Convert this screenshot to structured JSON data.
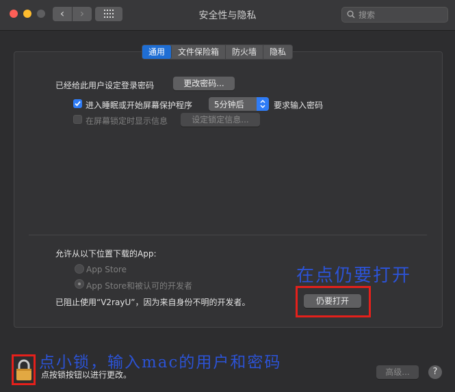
{
  "window": {
    "title": "安全性与隐私"
  },
  "search": {
    "placeholder": "搜索"
  },
  "tabs": [
    "通用",
    "文件保险箱",
    "防火墙",
    "隐私"
  ],
  "general": {
    "password_set_label": "已经给此用户设定登录密码",
    "change_password_button": "更改密码...",
    "require_password_prefix": "进入睡眠或开始屏幕保护程序",
    "require_password_delay": "5分钟后",
    "require_password_suffix": "要求输入密码",
    "require_password_checked": true,
    "show_message_label": "在屏幕锁定时显示信息",
    "show_message_checked": false,
    "set_lock_message_button": "设定锁定信息..."
  },
  "downloads": {
    "heading": "允许从以下位置下载的App:",
    "options": [
      "App Store",
      "App Store和被认可的开发者"
    ],
    "selected_index": 1,
    "blocked_message": "已阻止使用“V2rayU”，因为来自身份不明的开发者。",
    "open_anyway_button": "仍要打开"
  },
  "footer": {
    "lock_hint": "点按锁按钮以进行更改。",
    "advanced_button": "高级...",
    "help_button": "?"
  },
  "annotations": {
    "open_anyway_note": "在点仍要打开",
    "lock_note": "点小锁，输入mac的用户和密码"
  },
  "colors": {
    "accent": "#2f7cf6",
    "annotation_red": "#e5201b",
    "annotation_blue": "#2c53d6"
  },
  "icons": [
    "grid-icon",
    "search-icon",
    "chevron-left-icon",
    "chevron-right-icon",
    "lock-icon",
    "checkmark-icon",
    "updown-arrows-icon"
  ]
}
